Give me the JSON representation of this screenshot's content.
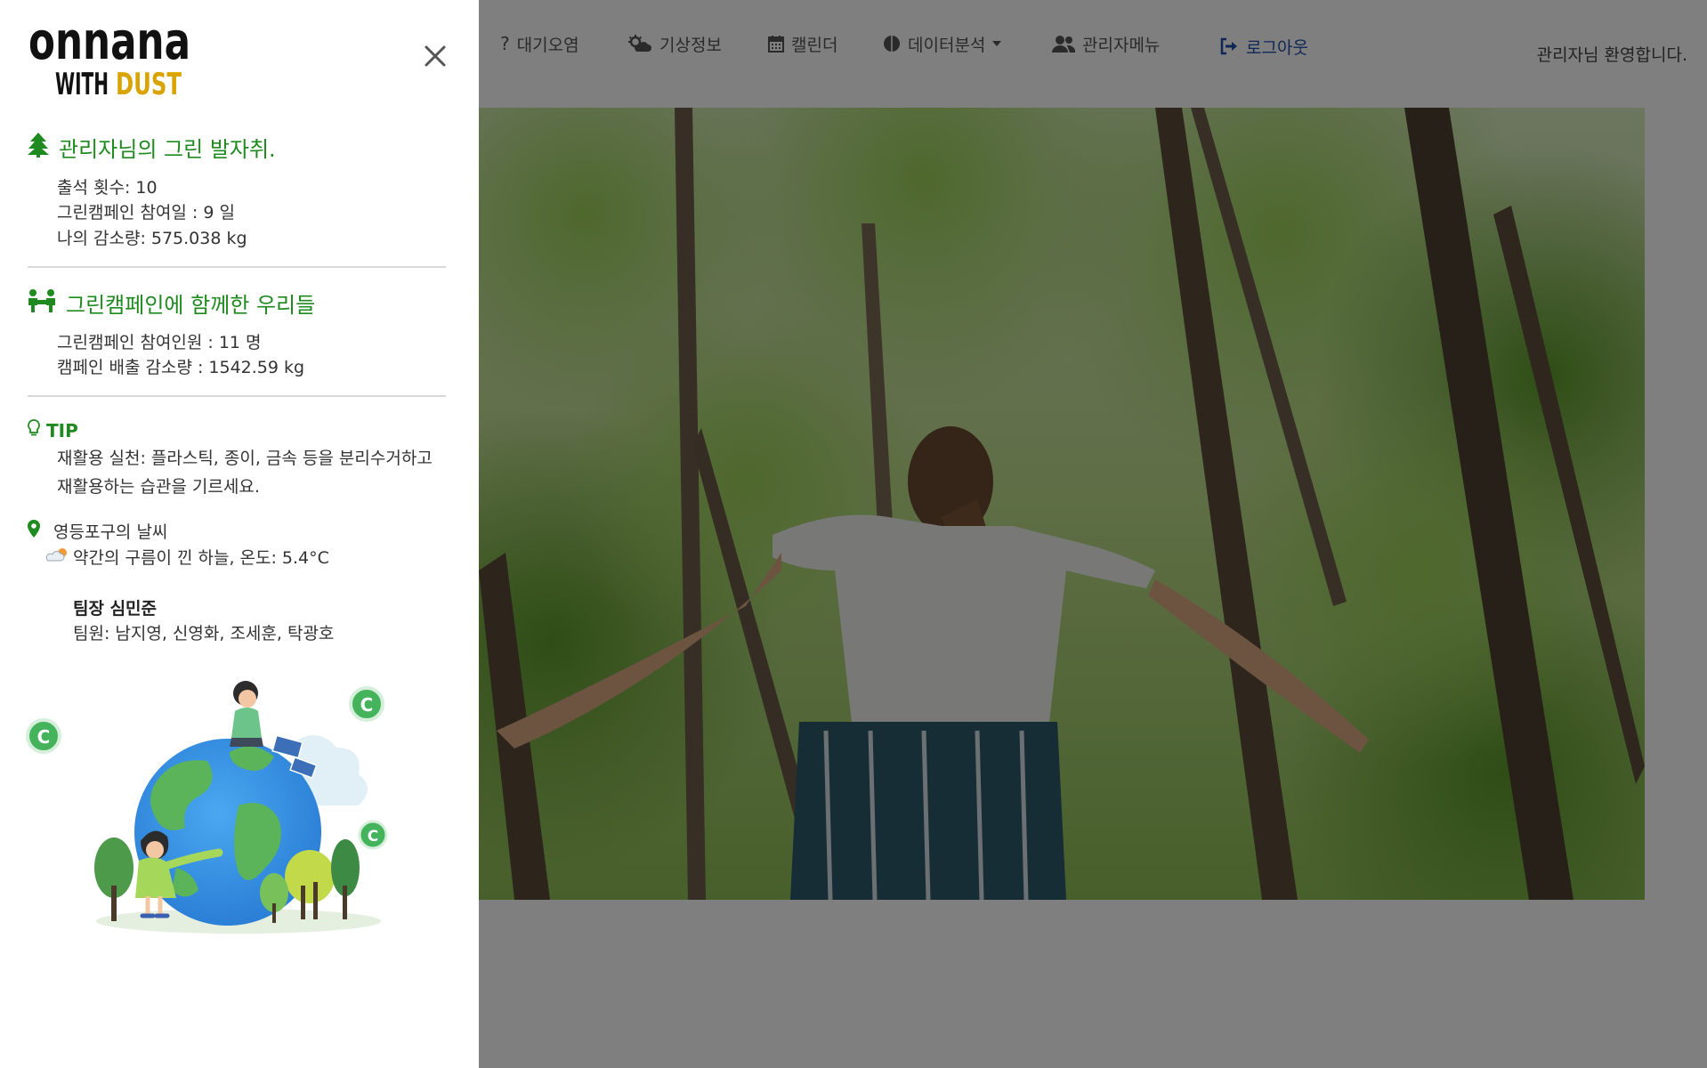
{
  "navbar": {
    "items": [
      {
        "label": "대기오염",
        "icon": "question-icon"
      },
      {
        "label": "기상정보",
        "icon": "cloud-sun-icon"
      },
      {
        "label": "캘린더",
        "icon": "calendar-icon"
      },
      {
        "label": "데이터분석",
        "icon": "brain-icon",
        "dropdown": true
      },
      {
        "label": "관리자메뉴",
        "icon": "users-icon"
      },
      {
        "label": "로그아웃",
        "icon": "logout-icon"
      }
    ],
    "welcome": "관리자님 환영합니다."
  },
  "sidebar": {
    "logo": {
      "line1": "onnana",
      "line2_a": "WITH",
      "line2_b": "DUST"
    },
    "green_steps": {
      "title": "관리자님의 그린 발자취.",
      "attendance": "출석 횟수: 10",
      "participation_days": "그린캠페인 참여일 : 9 일",
      "my_reduction": "나의 감소량: 575.038 kg"
    },
    "campaign": {
      "title": "그린캠페인에 함께한 우리들",
      "participants": "그린캠페인 참여인원 : 11 명",
      "emission_reduction": "캠페인 배출 감소량 : 1542.59 kg"
    },
    "tip": {
      "title": "TIP",
      "text": "재활용 실천: 플라스틱, 종이, 금속 등을 분리수거하고 재활용하는 습관을 기르세요."
    },
    "weather": {
      "location": "영등포구의 날씨",
      "description": "약간의 구름이 낀 하늘, 온도: 5.4°C"
    },
    "team": {
      "leader": "팀장 심민준",
      "members": "팀원: 남지영, 신영화, 조세훈, 탁광호"
    }
  },
  "colors": {
    "accent_green": "#1f8a1f",
    "logout_blue": "#1f4ea8",
    "logo_gold": "#d9a300",
    "overlay": "rgba(0,0,0,0.5)"
  }
}
